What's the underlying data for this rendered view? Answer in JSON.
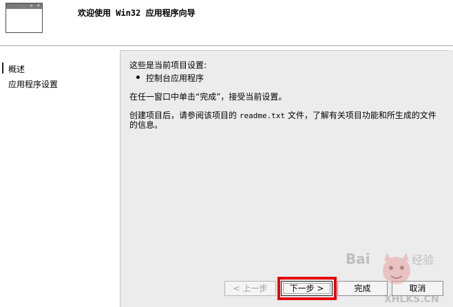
{
  "header": {
    "title": "欢迎使用 Win32 应用程序向导",
    "window_icon_buttons": "_ ▫ ×"
  },
  "nav": {
    "items": [
      {
        "label": "概述",
        "current": true
      },
      {
        "label": "应用程序设置",
        "current": false
      }
    ]
  },
  "content": {
    "intro": "这些是当前项目设置:",
    "bullet": "控制台应用程序",
    "finish_hint": "在任一窗口中单击“完成”，接受当前设置。",
    "after_create_line1_a": "创建项目后，请参阅该项目的 ",
    "after_create_line1_file": "readme.txt",
    "after_create_line1_b": " 文件，了解有关项目功能和所生成的文件",
    "after_create_line2": "的信息。"
  },
  "buttons": {
    "back": "< 上一步",
    "next": "下一步 >",
    "finish": "完成",
    "cancel": "取消"
  },
  "watermark": {
    "brand": "Bai 经验",
    "site": "XHLKS.CN"
  },
  "colors": {
    "panel_bg": "#ececec",
    "highlight": "#e5000b",
    "disabled_text": "#a0a0a0"
  }
}
